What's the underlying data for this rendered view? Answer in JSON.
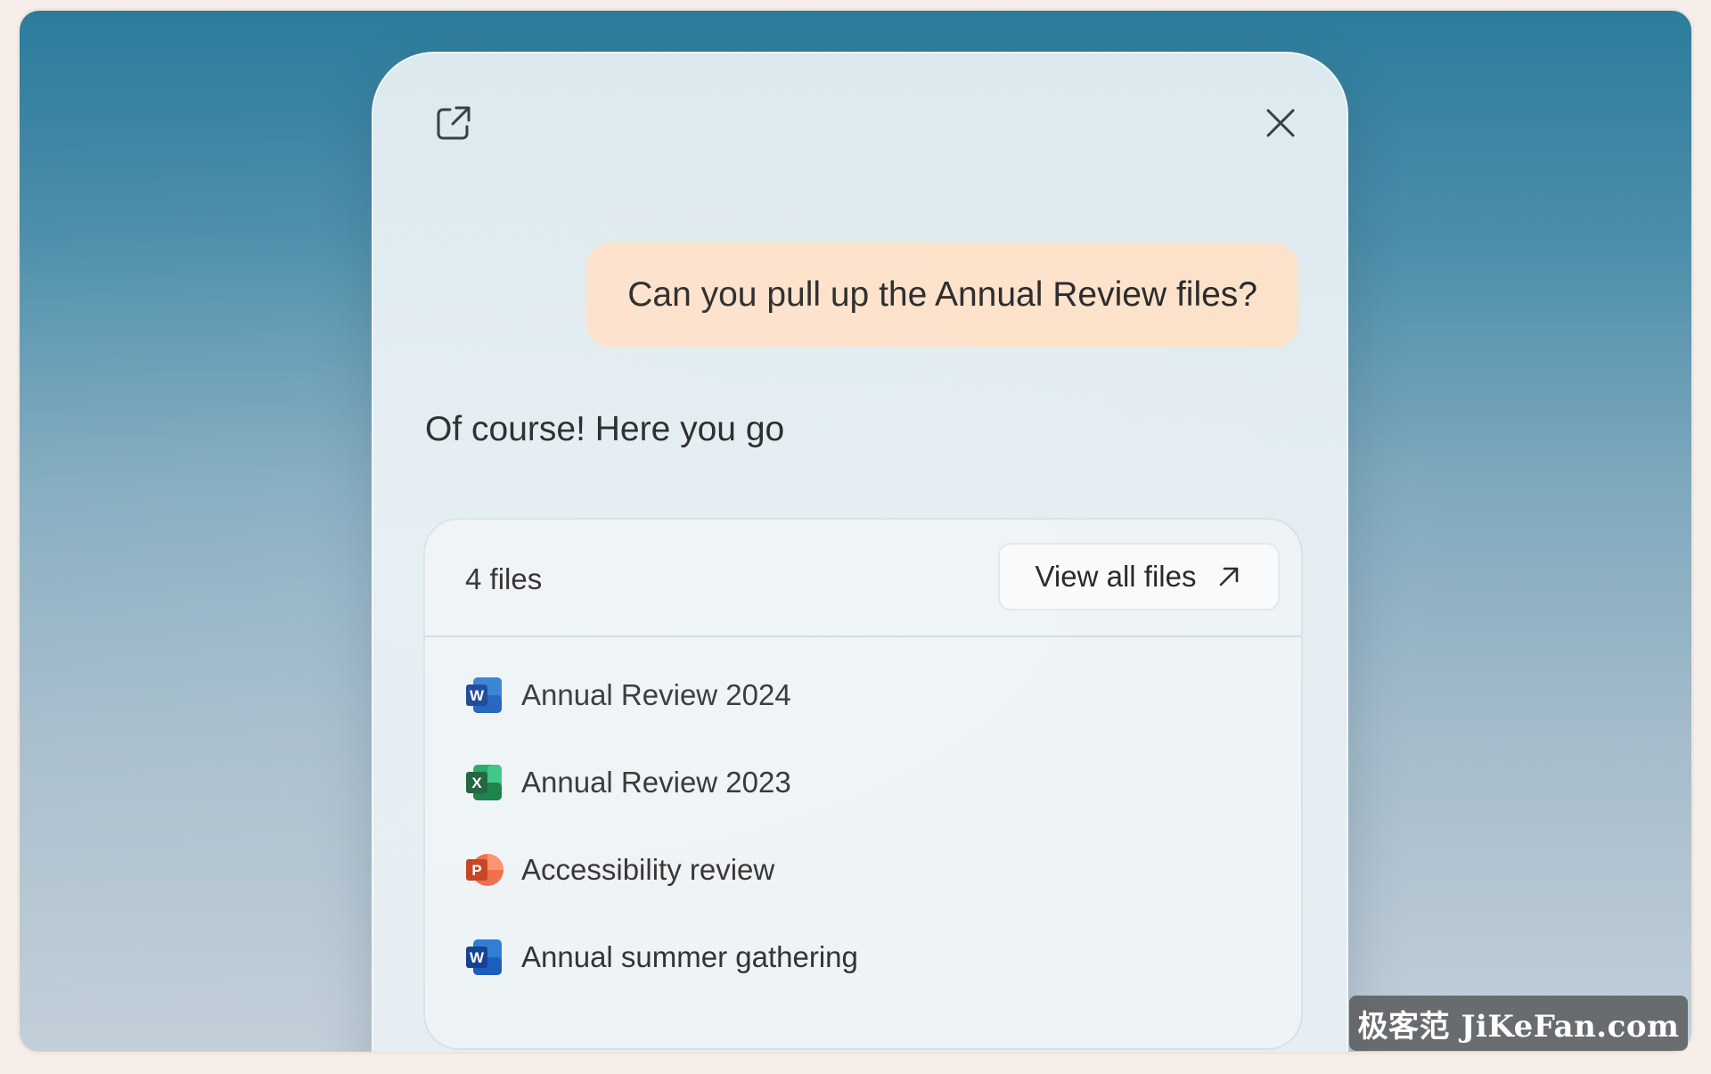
{
  "dialog": {
    "user_message": "Can you pull up the Annual Review files?",
    "assistant_reply": "Of course! Here you go"
  },
  "files_card": {
    "count_label": "4 files",
    "view_all_label": "View all files",
    "files": [
      {
        "name": "Annual Review 2024",
        "app": "word",
        "icon": "word-icon",
        "color": "#185abd"
      },
      {
        "name": "Annual Review 2023",
        "app": "excel",
        "icon": "excel-icon",
        "color": "#107c41"
      },
      {
        "name": "Accessibility review",
        "app": "powerpoint",
        "icon": "powerpoint-icon",
        "color": "#c43e1c"
      },
      {
        "name": "Annual summer gathering",
        "app": "word",
        "icon": "word-icon",
        "color": "#185abd"
      }
    ]
  },
  "icons": {
    "popout": "open-in-new-window-icon",
    "close": "close-icon",
    "view_all_arrow": "arrow-up-right-icon"
  },
  "watermark": "极客范 JiKeFan.com",
  "colors": {
    "user_bubble": "#fde2cb",
    "panel": "#e3edf2",
    "background_top": "#2c7c9c"
  }
}
